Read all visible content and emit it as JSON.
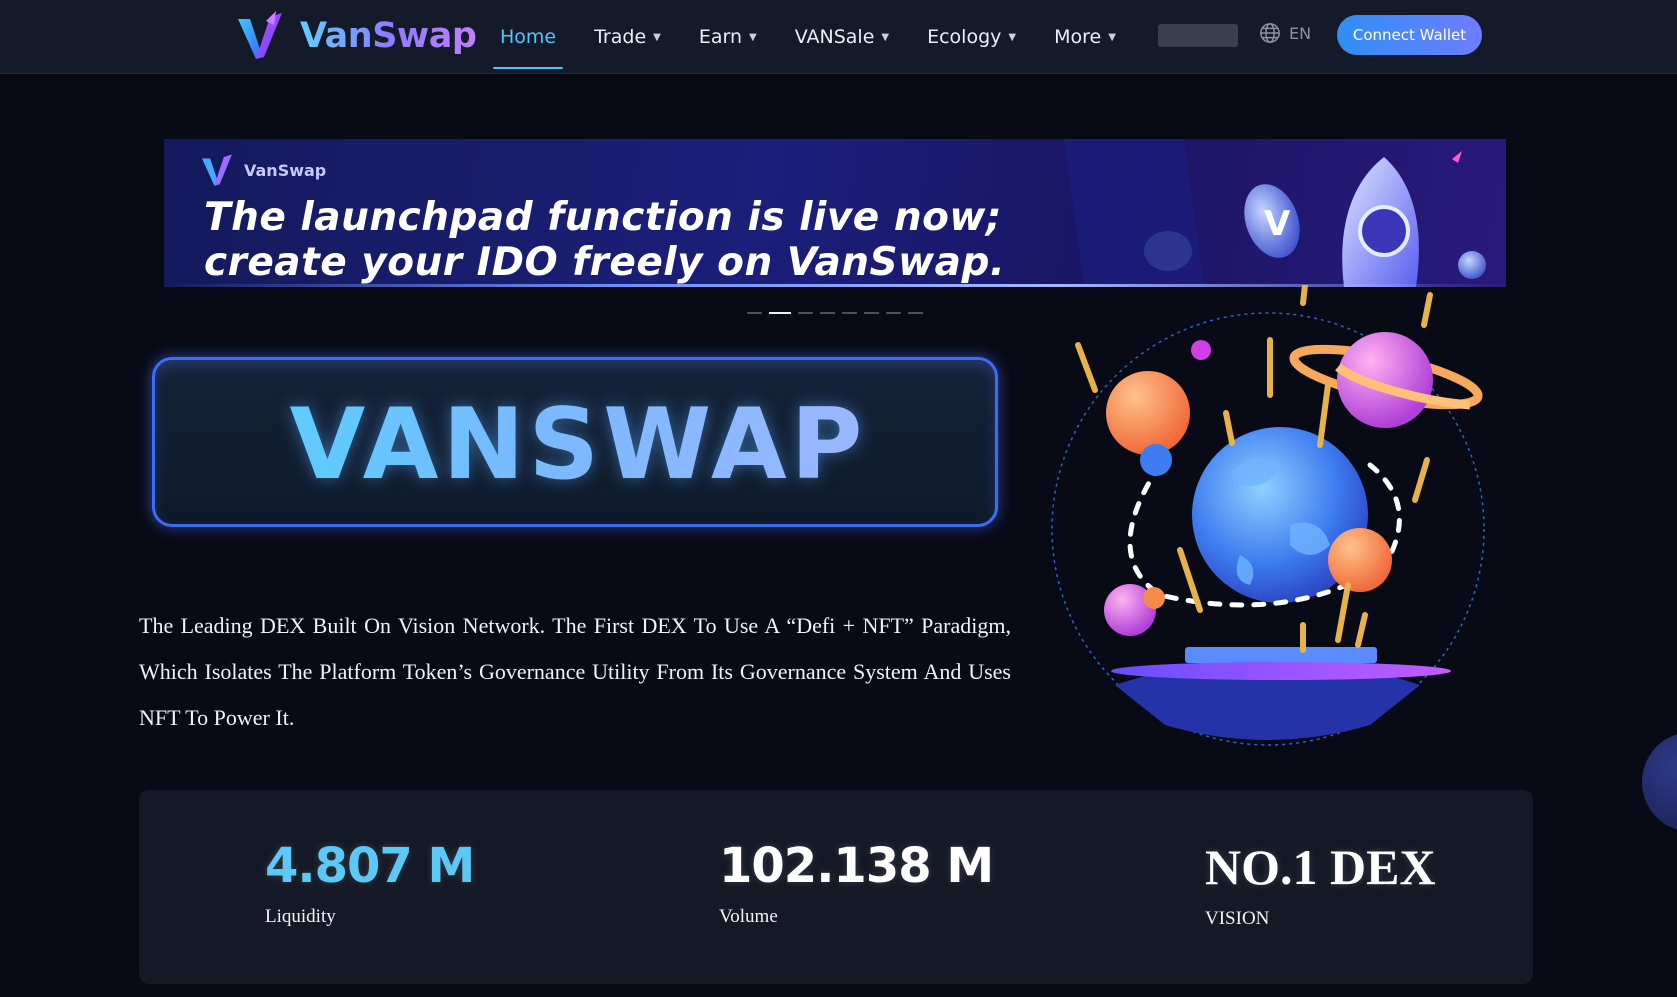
{
  "nav": {
    "brand": "VanSwap",
    "items": [
      {
        "label": "Home",
        "active": true,
        "has_dropdown": false
      },
      {
        "label": "Trade",
        "active": false,
        "has_dropdown": true
      },
      {
        "label": "Earn",
        "active": false,
        "has_dropdown": true
      },
      {
        "label": "VANSale",
        "active": false,
        "has_dropdown": true
      },
      {
        "label": "Ecology",
        "active": false,
        "has_dropdown": true
      },
      {
        "label": "More",
        "active": false,
        "has_dropdown": true
      }
    ],
    "language": "EN",
    "connect_label": "Connect Wallet"
  },
  "banner": {
    "brand": "VanSwap",
    "line1": "The launchpad function is live now;",
    "line2": "create your IDO freely on VanSwap.",
    "slide_count": 8,
    "active_slide": 1
  },
  "hero": {
    "title": "VANSWAP",
    "description": "The Leading DEX Built On Vision Network. The First DEX To Use A “Defi + NFT” Paradigm, Which Isolates The Platform Token’s Governance Utility From Its Governance System And Uses NFT To Power It."
  },
  "stats": [
    {
      "value": "4.807 M",
      "label": "Liquidity"
    },
    {
      "value": "102.138 M",
      "label": "Volume"
    },
    {
      "value": "NO.1 DEX",
      "label": "VISION"
    }
  ],
  "colors": {
    "accent": "#4fc6ff",
    "background": "#080b16",
    "navbar": "#151a2a",
    "stats_panel": "#151926",
    "button_start": "#2f8ff5",
    "button_end": "#6f7cff"
  },
  "icons": {
    "logo": "vanswap-v-logo",
    "language": "globe-icon",
    "dropdown": "caret-down-icon"
  }
}
